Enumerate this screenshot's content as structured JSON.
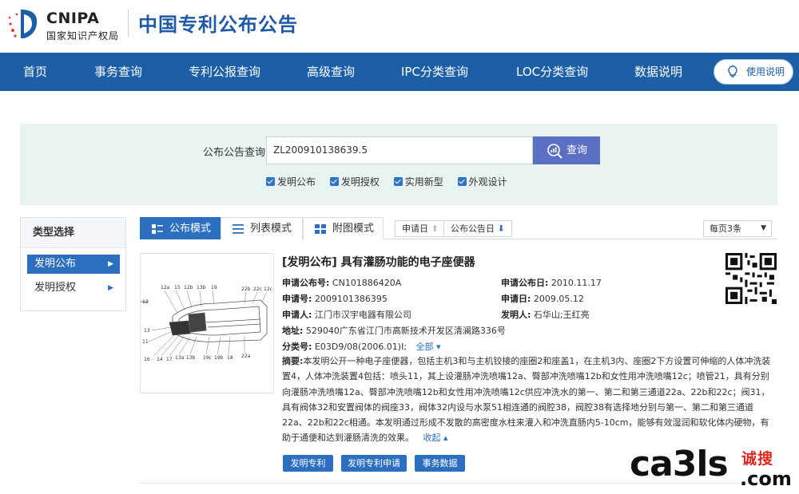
{
  "header": {
    "logo_en": "CNIPA",
    "logo_zh": "国家知识产权局",
    "site_title": "中国专利公布公告"
  },
  "nav": {
    "items": [
      "首页",
      "事务查询",
      "专利公报查询",
      "高级查询",
      "IPC分类查询",
      "LOC分类查询",
      "数据说明"
    ],
    "help_label": "使用说明"
  },
  "search": {
    "label": "公布公告查询",
    "value": "ZL200910138639.5",
    "button_label": "查询",
    "checkboxes": [
      {
        "label": "发明公布",
        "checked": true
      },
      {
        "label": "发明授权",
        "checked": true
      },
      {
        "label": "实用新型",
        "checked": true
      },
      {
        "label": "外观设计",
        "checked": true
      }
    ]
  },
  "sidebar": {
    "title": "类型选择",
    "items": [
      {
        "label": "发明公布",
        "active": true
      },
      {
        "label": "发明授权",
        "active": false
      }
    ]
  },
  "toolbar": {
    "tabs": [
      "公布模式",
      "列表模式",
      "附图模式"
    ],
    "sort_apply_date": "申请日",
    "sort_pub_date": "公布公告日",
    "per_page": "每页3条"
  },
  "result": {
    "title": "[发明公布] 具有灌肠功能的电子座便器",
    "pub_no_label": "申请公布号:",
    "pub_no": "CN101886420A",
    "pub_date_label": "申请公布日:",
    "pub_date": "2010.11.17",
    "app_no_label": "申请号:",
    "app_no": "2009101386395",
    "app_date_label": "申请日:",
    "app_date": "2009.05.12",
    "applicant_label": "申请人:",
    "applicant": "江门市汉宇电器有限公司",
    "inventor_label": "发明人:",
    "inventor": "石华山;王红亮",
    "address_label": "地址:",
    "address": "529040广东省江门市高新技术开发区清澜路336号",
    "class_label": "分类号:",
    "class_no": "E03D9/08(2006.01)I;",
    "class_all": "全部",
    "abstract_label": "摘要:",
    "abstract": "本发明公开一种电子座便器，包括主机3和与主机铰接的座圈2和座盖1，在主机3内、座圈2下方设置可伸缩的人体冲洗装置4，人体冲洗装置4包括：喷头11，其上设灌肠冲洗喷嘴12a、臀部冲洗喷嘴12b和女性用冲洗喷嘴12c；喷管21，具有分别向灌肠冲洗喷嘴12a、臀部冲洗喷嘴12b和女性用冲洗喷嘴12c供应冲洗水的第一、第二和第三通道22a、22b和22c；阀31，具有阀体32和安置阀体的阀座33，阀体32内设与水泵51相连通的阀腔38，阀腔38有选择地分别与第一、第二和第三通道22a、22b和22c相通。本发明通过形成不发散的高密度水柱来灌入和冲洗直肠内5-10cm，能够有效湿润和软化体内硬物，有助于通便和达到灌肠清洗的效果。",
    "collapse": "收起",
    "actions": [
      "发明专利",
      "发明专利申请",
      "事务数据"
    ],
    "figure_labels": [
      "12a",
      "15",
      "12b",
      "13b",
      "19",
      "22b",
      "22c",
      "12c",
      "12",
      "13",
      "11",
      "16",
      "14",
      "17",
      "13a",
      "13b",
      "19c",
      "19b",
      "18",
      "22a"
    ]
  },
  "watermark": {
    "big": "ca3ls",
    "cn": "诚搜",
    "com": ".com"
  }
}
